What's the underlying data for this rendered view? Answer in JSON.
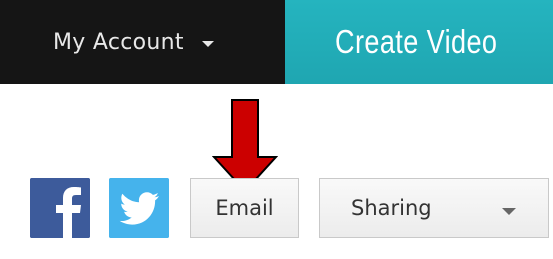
{
  "header": {
    "account_label": "My Account",
    "account_caret_icon": "caret-down-icon",
    "create_video_label": "Create Video",
    "create_video_color": "#25b4bf",
    "account_bg_color": "#151515"
  },
  "annotation": {
    "arrow_icon": "arrow-down-icon",
    "arrow_color": "#cc0000"
  },
  "share_bar": {
    "facebook_icon": "facebook-icon",
    "facebook_color": "#3b5999",
    "twitter_icon": "twitter-icon",
    "twitter_color": "#45b3ec",
    "email_label": "Email",
    "sharing_label": "Sharing",
    "sharing_caret_icon": "caret-down-icon"
  }
}
